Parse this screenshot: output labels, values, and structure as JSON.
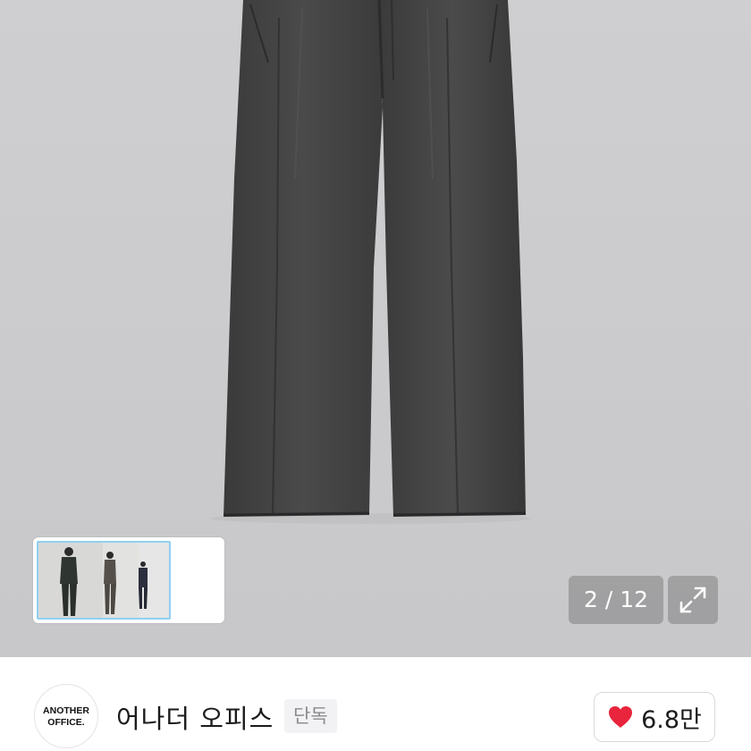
{
  "gallery": {
    "current": "2",
    "total": "12",
    "counter_text": "2 / 12",
    "expand_icon": "expand-arrows-icon",
    "thumbnail_icon": "outfit-photo-thumbnail"
  },
  "brand": {
    "logo_line1": "ANOTHER",
    "logo_line2": "OFFICE.",
    "name": "어나더 오피스",
    "badge": "단독"
  },
  "like": {
    "icon": "heart-icon",
    "count": "6.8만",
    "color": "#e8253c"
  }
}
